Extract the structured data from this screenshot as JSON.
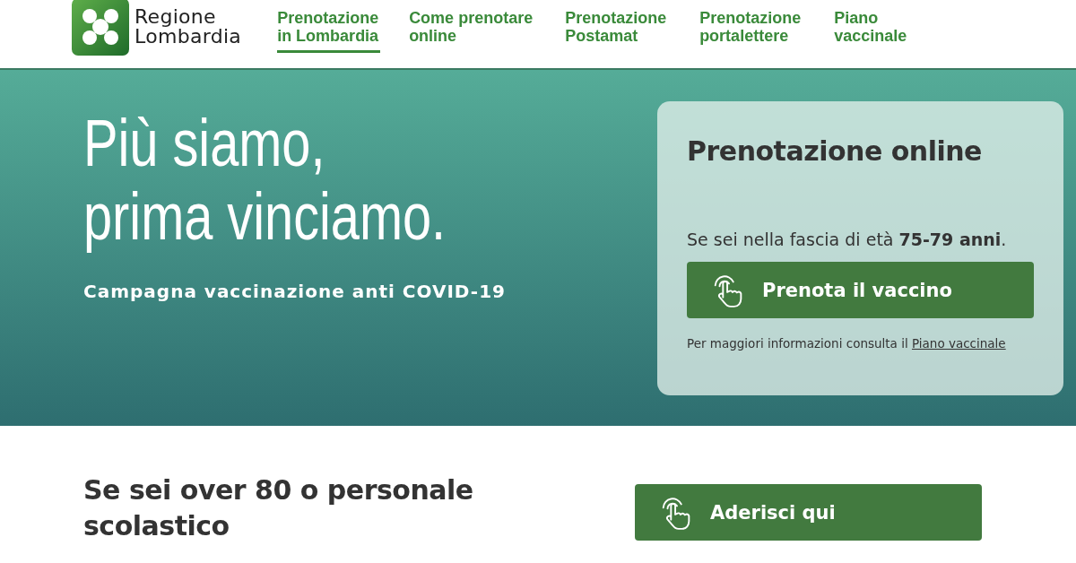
{
  "header": {
    "logo_text": [
      "Regione",
      "Lombardia"
    ],
    "nav": [
      {
        "label": "Prenotazione in Lombardia",
        "selected": true
      },
      {
        "label": "Come prenotare online",
        "selected": false
      },
      {
        "label": "Prenotazione Postamat",
        "selected": false
      },
      {
        "label": "Prenotazione portalettere",
        "selected": false
      },
      {
        "label": "Piano vaccinale",
        "selected": false
      }
    ]
  },
  "hero": {
    "headline_lines": [
      "Più siamo,",
      "prima vinciamo."
    ],
    "subtitle": "Campagna vaccinazione anti COVID-19",
    "card": {
      "title": "Prenotazione online",
      "eligibility": "Se sei nella fascia di età **75-79 anni**.",
      "button": "Prenota il vaccino",
      "info_text": "Per maggiori informazioni consulta il",
      "info_link": "Piano vaccinale"
    }
  },
  "section": {
    "heading": "Se sei over 80 o personale scolastico",
    "button": "Aderisci qui"
  }
}
